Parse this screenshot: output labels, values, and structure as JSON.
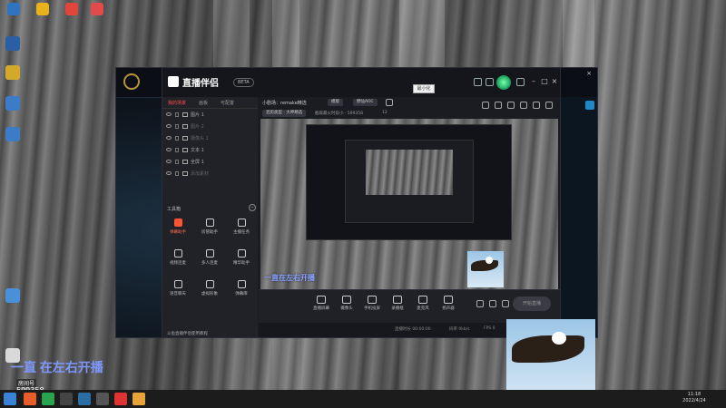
{
  "app": {
    "title": "直播伴侣",
    "version": "BETA",
    "tooltip": "最小化"
  },
  "left_panel": {
    "tabs": [
      "我的场景",
      "画板",
      "可配置"
    ],
    "scenes": [
      {
        "name": "图片 1",
        "dim": false
      },
      {
        "name": "图片 2",
        "dim": true
      },
      {
        "name": "摄像头 1",
        "dim": true
      },
      {
        "name": "文本 1",
        "dim": false
      },
      {
        "name": "全屏 1",
        "dim": false
      },
      {
        "name": "添加素材",
        "dim": true
      }
    ],
    "tools_title": "工具箱",
    "tools": [
      {
        "label": "弹幕助手",
        "active": true
      },
      {
        "label": "房管助手",
        "active": false
      },
      {
        "label": "主播任务",
        "active": false
      },
      {
        "label": "视频连麦",
        "active": false
      },
      {
        "label": "多人连麦",
        "active": false
      },
      {
        "label": "精华助手",
        "active": false
      },
      {
        "label": "语音聊天",
        "active": false
      },
      {
        "label": "虚拟形象",
        "active": false
      },
      {
        "label": "弹幕库",
        "active": false
      }
    ],
    "bottom_link": "斗鱼直播伴侣使用教程"
  },
  "main": {
    "room_title_prefix": "小剧场：",
    "room_title": "remake精选",
    "category_pill": "模版",
    "tag_pill": "野仙AOC",
    "info_pill": "混剪类型 · 大神精选",
    "info_text": "截取最火时段小 · 599358",
    "hot_count": "12",
    "overlay_title": "一直在左右开播",
    "controls": [
      "直播屏幕",
      "摄像头",
      "手机投屏",
      "录播框",
      "麦克风",
      "扬声器"
    ],
    "start_button": "开始直播",
    "status": [
      "直播时长 00:00:00",
      "码率 0kb/s",
      "FPS 0",
      "CPU 4%"
    ]
  },
  "desktop": {
    "overlay_text": "一直 在左右开播",
    "streamer_label": "房间号",
    "room_id": "599358"
  },
  "taskbar": {
    "time": "11:18",
    "date": "2022/4/24"
  }
}
